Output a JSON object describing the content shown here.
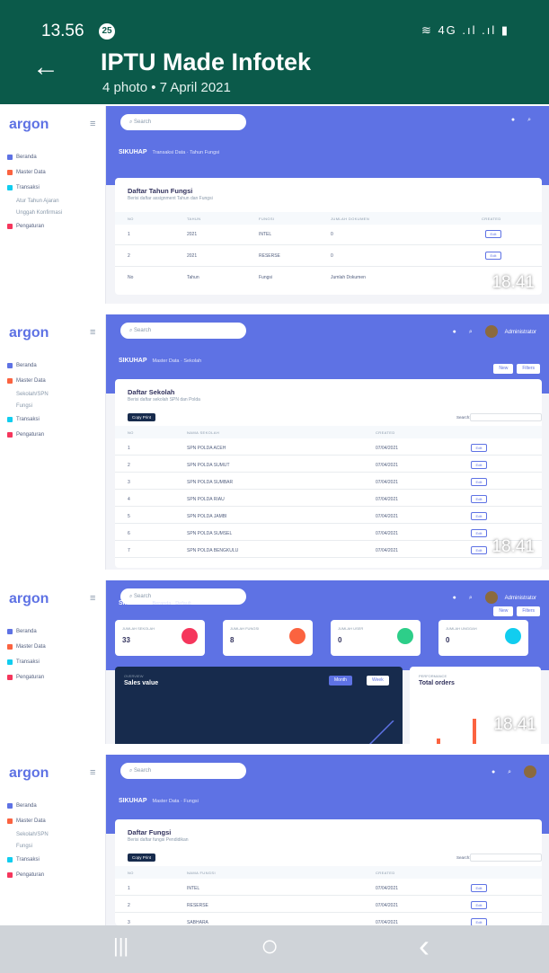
{
  "status": {
    "time": "13.56",
    "badge": "25",
    "icons": "≋ 4G .ıl .ıl ▮"
  },
  "header": {
    "back": "←",
    "title": "IPTU Made Infotek",
    "subtitle": "4 photo • 7 April 2021"
  },
  "overlay_time": "18.41",
  "common": {
    "logo": "argon",
    "search_placeholder": "Search",
    "nav_dashboard": "Beranda",
    "nav_master": "Master Data",
    "nav_transaksi": "Transaksi",
    "nav_pengaturan": "Pengaturan",
    "brand": "SIKUHAP",
    "user": "Administrator"
  },
  "panel1": {
    "nav_sub1": "Atur Tahun Ajaran",
    "nav_sub2": "Unggah Konfirmasi",
    "crumb": "Transaksi Data · Tahun Fungsi",
    "card_title": "Daftar Tahun Fungsi",
    "card_sub": "Berisi daftar assignment Tahun dan Fungsi",
    "headers": [
      "NO",
      "TAHUN",
      "FUNGSI",
      "JUMLAH DOKUMEN",
      "CREATED"
    ],
    "rows": [
      [
        "1",
        "2021",
        "INTEL",
        "0"
      ],
      [
        "2",
        "2021",
        "RESERSE",
        "0"
      ]
    ],
    "footer": [
      "No",
      "Tahun",
      "Fungsi",
      "Jumlah Dokumen"
    ],
    "edit": "Edit"
  },
  "panel2": {
    "nav_sub1": "Sekolah/SPN",
    "nav_sub2": "Fungsi",
    "crumb": "Master Data · Sekolah",
    "btn_new": "New",
    "btn_filter": "Filters",
    "card_title": "Daftar Sekolah",
    "card_sub": "Berisi daftar sekolah SPN dan Polda",
    "copy": "Copy",
    "print": "Print",
    "search_label": "Search:",
    "headers": [
      "NO",
      "NAMA SEKOLAH",
      "CREATED"
    ],
    "rows": [
      [
        "1",
        "SPN POLDA ACEH",
        "07/04/2021"
      ],
      [
        "2",
        "SPN POLDA SUMUT",
        "07/04/2021"
      ],
      [
        "3",
        "SPN POLDA SUMBAR",
        "07/04/2021"
      ],
      [
        "4",
        "SPN POLDA RIAU",
        "07/04/2021"
      ],
      [
        "5",
        "SPN POLDA JAMBI",
        "07/04/2021"
      ],
      [
        "6",
        "SPN POLDA SUMSEL",
        "07/04/2021"
      ],
      [
        "7",
        "SPN POLDA BENGKULU",
        "07/04/2021"
      ]
    ],
    "edit": "Edit"
  },
  "panel3": {
    "crumb": "Beranda · Default",
    "btn_new": "New",
    "btn_filter": "Filters",
    "stats": [
      {
        "label": "JUMLAH SEKOLAH",
        "value": "33",
        "color": "#f5365c"
      },
      {
        "label": "JUMLAH FUNGSI",
        "value": "8",
        "color": "#fb6340"
      },
      {
        "label": "JUMLAH USER",
        "value": "0",
        "color": "#2dce89"
      },
      {
        "label": "JUMLAH UNGGAH",
        "value": "0",
        "color": "#11cdef"
      }
    ],
    "sales_over": "OVERVIEW",
    "sales_title": "Sales value",
    "sales_month": "Month",
    "sales_week": "Week",
    "orders_over": "PERFORMANCE",
    "orders_title": "Total orders"
  },
  "panel4": {
    "nav_sub1": "Sekolah/SPN",
    "nav_sub2": "Fungsi",
    "crumb": "Master Data · Fungsi",
    "card_title": "Daftar Fungsi",
    "card_sub": "Berisi daftar fungsi Pendidikan",
    "copy": "Copy",
    "print": "Print",
    "search_label": "Search:",
    "headers": [
      "NO",
      "NAMA FUNGSI",
      "CREATED"
    ],
    "rows": [
      [
        "1",
        "INTEL",
        "07/04/2021"
      ],
      [
        "2",
        "RESERSE",
        "07/04/2021"
      ],
      [
        "3",
        "SABHARA",
        "07/04/2021"
      ],
      [
        "4",
        "BINMAS",
        "07/04/2021"
      ]
    ],
    "edit": "Edit"
  },
  "navbar": {
    "recent": "|||",
    "home": "○",
    "back": "‹"
  }
}
